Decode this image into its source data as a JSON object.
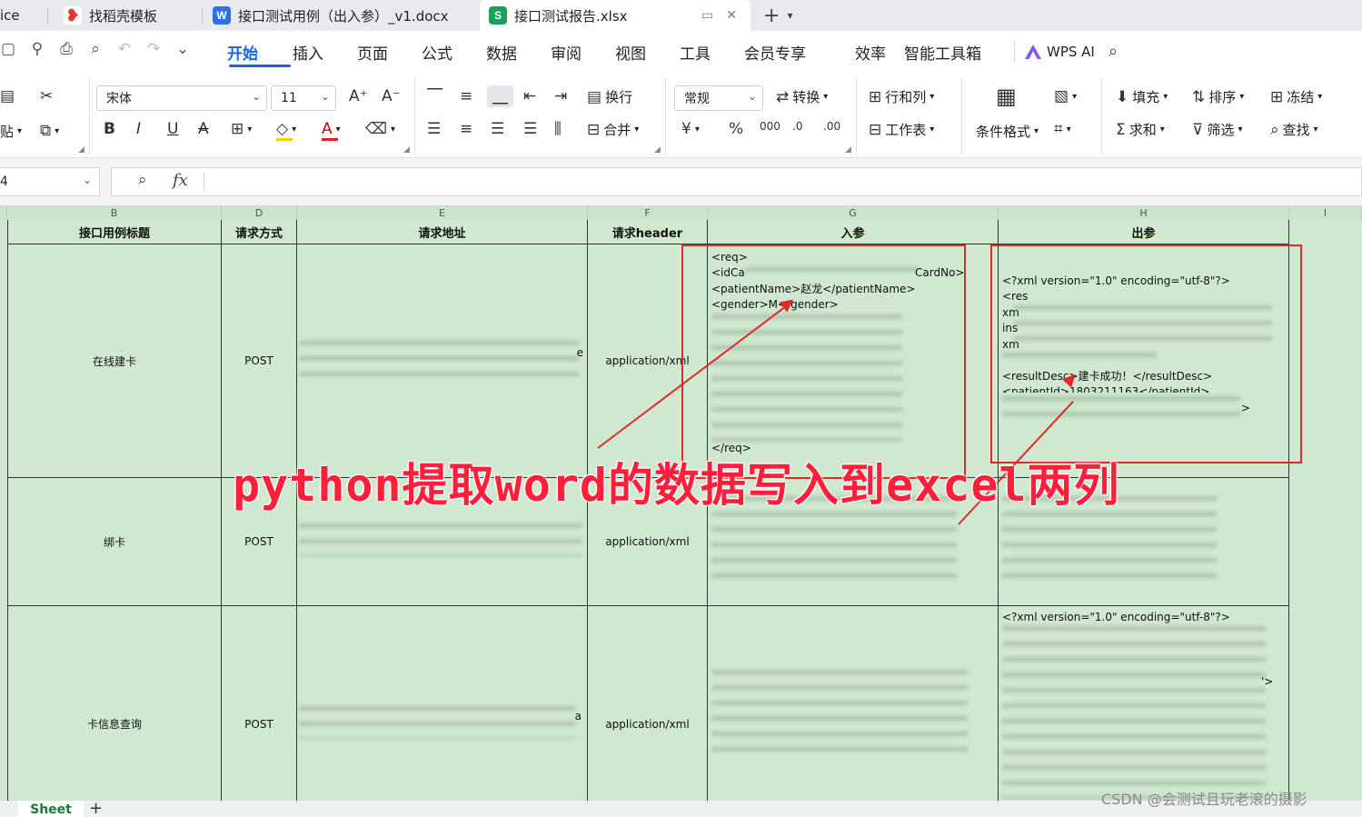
{
  "tabs": [
    {
      "label": "ice",
      "icon": "none"
    },
    {
      "label": "找稻壳模板",
      "icon": "docer-icon"
    },
    {
      "label": "接口测试用例（出入参）_v1.docx",
      "icon": "word-icon"
    },
    {
      "label": "接口测试报告.xlsx",
      "icon": "sheet-icon",
      "active": true
    }
  ],
  "tab_icon_letters": {
    "word": "W",
    "sheet": "S"
  },
  "menu": [
    "开始",
    "插入",
    "页面",
    "公式",
    "数据",
    "审阅",
    "视图",
    "工具",
    "会员专享",
    "效率",
    "智能工具箱"
  ],
  "wps_ai": "WPS AI",
  "ribbon": {
    "paste": "贴",
    "font_name": "宋体",
    "font_size": "11",
    "wrap": "换行",
    "merge": "合并",
    "number_format": "常规",
    "convert": "转换",
    "row_col": "行和列",
    "worksheet": "工作表",
    "cond_format": "条件格式",
    "fill": "填充",
    "sort": "排序",
    "freeze": "冻结",
    "sum": "求和",
    "filter": "筛选",
    "find": "查找"
  },
  "formula_bar": {
    "name_box": "4",
    "fx": "fx"
  },
  "colors": {
    "accent": "#1a66d6",
    "grid_bg": "#cfe8cf",
    "annotation": "#e02a2a",
    "overlay_text": "#ff1f3b"
  },
  "columns": [
    "B",
    "D",
    "E",
    "F",
    "G",
    "H",
    "I"
  ],
  "header_row": [
    "接口用例标题",
    "请求方式",
    "请求地址",
    "请求header",
    "入参",
    "出参"
  ],
  "rows": [
    {
      "title": "在线建卡",
      "method": "POST",
      "header": "application/xml"
    },
    {
      "title": "绑卡",
      "method": "POST",
      "header": "application/xml"
    },
    {
      "title": "卡信息查询",
      "method": "POST",
      "header": "application/xml"
    }
  ],
  "url_tail": {
    "row1": "e",
    "row3": "a"
  },
  "input_xml_row1": [
    "<req>",
    "<idCa",
    "CardNo>",
    "<patientName>赵龙</patientName>",
    "<gender>M</gender>",
    "</req>"
  ],
  "output_xml_row1": [
    "<?xml version=\"1.0\" encoding=\"utf-8\"?>",
    "<res",
    "xm",
    "ins",
    "xm",
    "<resultDesc>建卡成功！</resultDesc>",
    "<patientId>1803211163</patientId>",
    ">"
  ],
  "output_xml_row3_first": "<?xml version=\"1.0\" encoding=\"utf-8\"?>",
  "output_xml_row3_tail": "'>",
  "overlay_title": "python提取word的数据写入到excel两列",
  "sheet_tab": "Sheet",
  "watermark": "CSDN @会测试且玩老滚的摄影"
}
